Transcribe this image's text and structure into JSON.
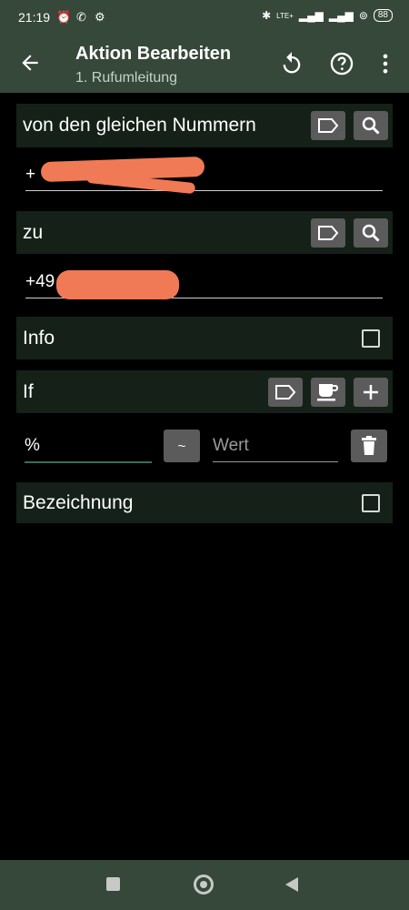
{
  "status": {
    "time": "21:19",
    "lte": "LTE+",
    "battery": "88"
  },
  "appbar": {
    "title": "Aktion Bearbeiten",
    "subtitle": "1. Rufumleitung"
  },
  "section_from": {
    "label": "von den gleichen Nummern",
    "value": "+"
  },
  "section_to": {
    "label": "zu",
    "value": "+49"
  },
  "info": {
    "label": "Info",
    "checked": false
  },
  "if_row": {
    "label": "If"
  },
  "condition": {
    "variable": "%",
    "operator": "~",
    "value_placeholder": "Wert"
  },
  "bezeichnung": {
    "label": "Bezeichnung",
    "checked": false
  },
  "colors": {
    "bar": "#35483a",
    "row": "#152118",
    "button": "#5b5b5b",
    "redaction": "#f07a55"
  }
}
